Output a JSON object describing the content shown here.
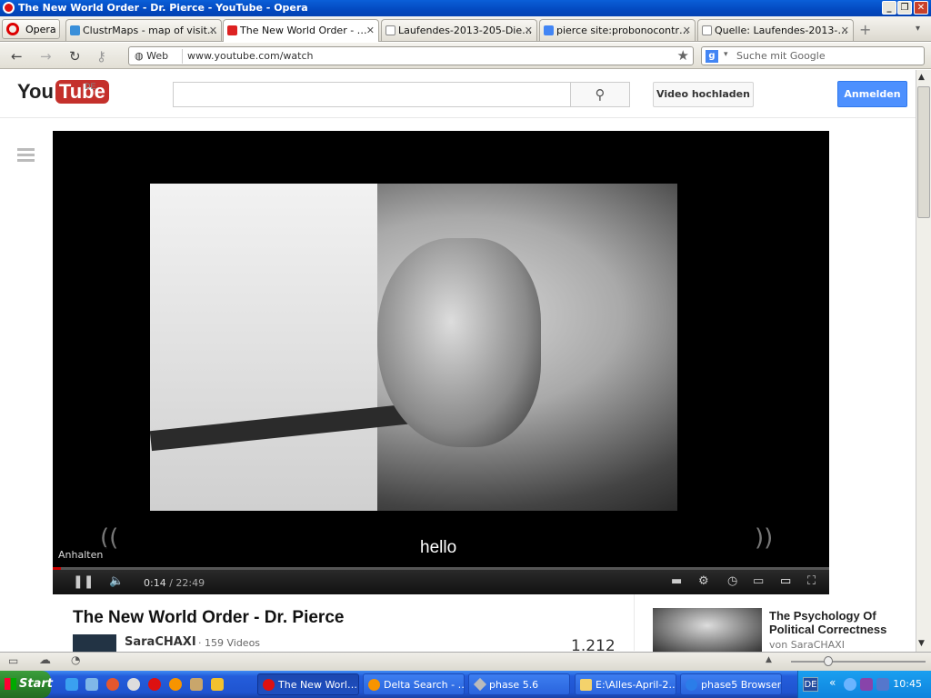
{
  "window": {
    "title": "The New World Order - Dr. Pierce - YouTube - Opera"
  },
  "browser": {
    "menu_button": "Opera",
    "tabs": [
      {
        "label": "ClustrMaps - map of visit…",
        "icon": "clustrmaps-icon"
      },
      {
        "label": "The New World Order - …",
        "icon": "youtube-icon",
        "active": true
      },
      {
        "label": "Laufendes-2013-205-Die…",
        "icon": "page-icon"
      },
      {
        "label": "pierce site:probonocontr…",
        "icon": "google-icon"
      },
      {
        "label": "Quelle: Laufendes-2013-…",
        "icon": "page-icon"
      }
    ],
    "address": {
      "badge": "Web",
      "url": "www.youtube.com/watch"
    },
    "search": {
      "placeholder": "Suche mit Google"
    }
  },
  "youtube": {
    "logo_you": "You",
    "logo_tube": "Tube",
    "logo_region": "DE",
    "upload_label": "Video hochladen",
    "signin_label": "Anmelden",
    "player": {
      "caption": "hello",
      "tooltip": "Anhalten",
      "current_time": "0:14",
      "total_time": "/ 22:49",
      "progress_fraction": 0.0104
    },
    "video": {
      "title": "The New World Order - Dr. Pierce",
      "channel": "SaraCHAXI",
      "channel_videos": "· 159 Videos",
      "views": "1.212"
    },
    "related": [
      {
        "title": "The Psychology Of Political Correctness",
        "by": "von SaraCHAXI"
      }
    ]
  },
  "taskbar": {
    "start": "Start",
    "items": [
      {
        "label": "The New Worl…",
        "icon": "opera-icon",
        "active": true
      },
      {
        "label": "Delta Search - …",
        "icon": "firefox-icon"
      },
      {
        "label": "phase 5.6",
        "icon": "diamond-icon"
      },
      {
        "label": "E:\\Alles-April-2…",
        "icon": "folder-icon"
      },
      {
        "label": "phase5 Browser",
        "icon": "globe-icon"
      }
    ],
    "lang": "DE",
    "clock": "10:45"
  }
}
